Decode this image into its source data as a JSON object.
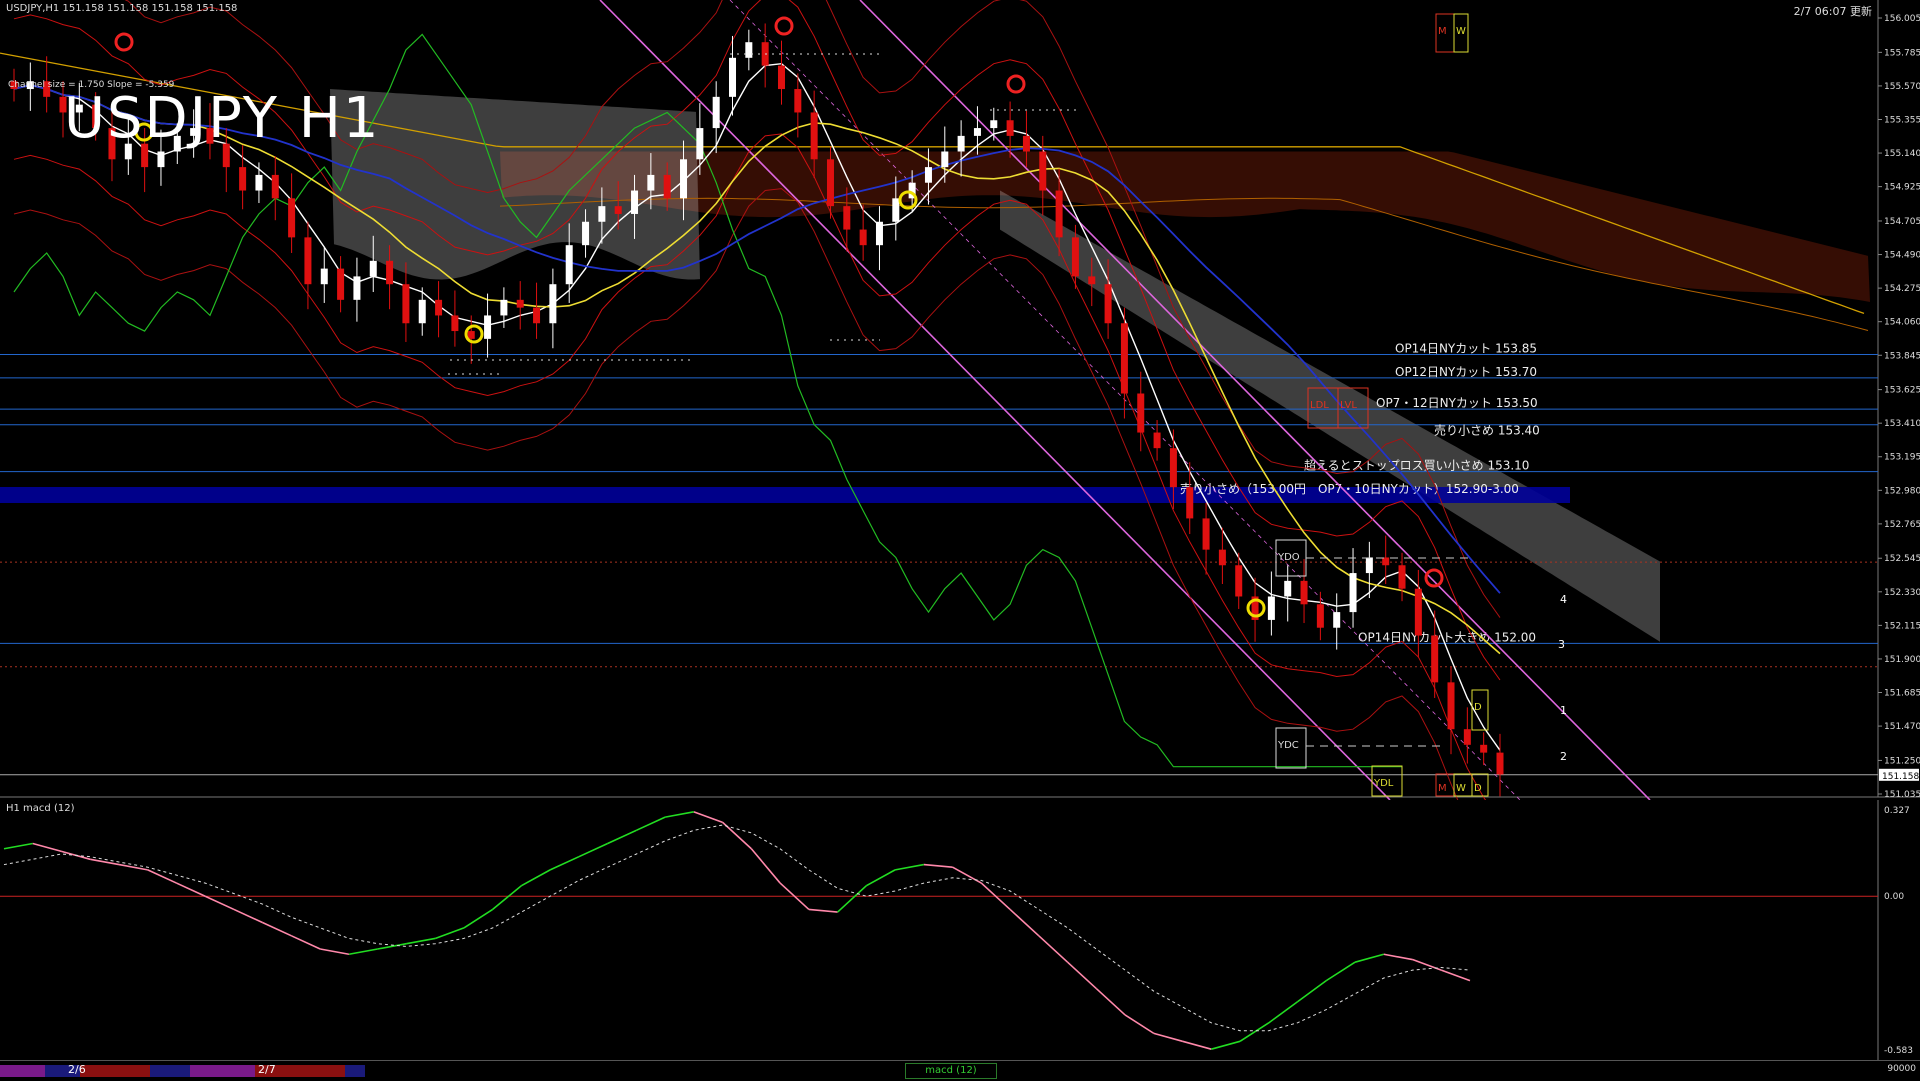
{
  "header": {
    "symbol_info": "USDJPY,H1  151.158 151.158 151.158 151.158",
    "channel_info": "Channel size = 1.750  Slope = -5.359",
    "big_title": "USDJPY H1",
    "datetime": "2/7 06:07 更新",
    "mw_markers": [
      "M",
      "W"
    ]
  },
  "macd_panel": {
    "title": "H1  macd (12)",
    "axis_labels": [
      "0.327",
      "0.00",
      "-0.583"
    ]
  },
  "bottom_bar": {
    "dates": [
      "2/6",
      "2/7"
    ],
    "status_tab": "macd (12)",
    "right_label": "90000"
  },
  "colors": {
    "bull_candle": "#ffffff",
    "bear_candle": "#e01010",
    "cloud_up": "#dddddd",
    "cloud_down": "#c03010",
    "level_band": "#000099",
    "macd_up": "#22dd22",
    "macd_down": "#ff88aa",
    "channel": "#dd66dd"
  },
  "chart_data": {
    "type": "candlestick",
    "symbol": "USDJPY",
    "timeframe": "H1",
    "ylim": [
      151.035,
      156.005
    ],
    "y_ticks": [
      156.005,
      155.785,
      155.57,
      155.355,
      155.14,
      154.925,
      154.705,
      154.49,
      154.275,
      154.06,
      153.845,
      153.625,
      153.41,
      153.195,
      152.98,
      152.765,
      152.545,
      152.33,
      152.115,
      151.9,
      151.685,
      151.47,
      151.25,
      151.035
    ],
    "current_price": "151.158",
    "candles_close": [
      155.55,
      155.6,
      155.5,
      155.4,
      155.45,
      155.3,
      155.1,
      155.2,
      155.05,
      155.15,
      155.25,
      155.3,
      155.2,
      155.05,
      154.9,
      155.0,
      154.85,
      154.6,
      154.3,
      154.4,
      154.2,
      154.35,
      154.45,
      154.3,
      154.05,
      154.2,
      154.1,
      154.0,
      153.95,
      154.1,
      154.2,
      154.15,
      154.05,
      154.3,
      154.55,
      154.7,
      154.8,
      154.75,
      154.9,
      155.0,
      154.85,
      155.1,
      155.3,
      155.5,
      155.75,
      155.85,
      155.7,
      155.55,
      155.4,
      155.1,
      154.8,
      154.65,
      154.55,
      154.7,
      154.85,
      154.95,
      155.05,
      155.15,
      155.25,
      155.3,
      155.35,
      155.25,
      155.15,
      154.9,
      154.6,
      154.35,
      154.3,
      154.05,
      153.6,
      153.35,
      153.25,
      153.0,
      152.8,
      152.6,
      152.5,
      152.3,
      152.15,
      152.3,
      152.4,
      152.25,
      152.1,
      152.2,
      152.45,
      152.55,
      152.5,
      152.35,
      152.05,
      151.75,
      151.45,
      151.35,
      151.3,
      151.16
    ],
    "annotations": [
      {
        "text": "OP14日NYカット 153.85",
        "price": 153.85
      },
      {
        "text": "OP12日NYカット 153.70",
        "price": 153.7
      },
      {
        "text": "OP7・12日NYカット 153.50",
        "price": 153.5
      },
      {
        "text": "売り小さめ 153.40",
        "price": 153.4
      },
      {
        "text": "超えるとストップロス買い小さめ 153.10",
        "price": 153.1
      },
      {
        "text": "売り小さめ（153.00円　OP7・10日NYカット）152.90-3.00",
        "price": 152.95
      },
      {
        "text": "OP14日NYカット大きめ 152.00",
        "price": 152.0
      }
    ],
    "box_labels": [
      "YDO",
      "YDC",
      "YDL",
      "LDL",
      "LVL",
      "M",
      "W",
      "D"
    ],
    "channel_numbers": [
      "1",
      "2",
      "3",
      "4"
    ],
    "macd_main": [
      0.18,
      0.2,
      0.17,
      0.14,
      0.12,
      0.1,
      0.05,
      0.0,
      -0.05,
      -0.1,
      -0.15,
      -0.2,
      -0.22,
      -0.2,
      -0.18,
      -0.16,
      -0.12,
      -0.05,
      0.04,
      0.1,
      0.15,
      0.2,
      0.25,
      0.3,
      0.32,
      0.28,
      0.18,
      0.05,
      -0.05,
      -0.06,
      0.04,
      0.1,
      0.12,
      0.11,
      0.05,
      -0.05,
      -0.15,
      -0.25,
      -0.35,
      -0.45,
      -0.52,
      -0.55,
      -0.58,
      -0.55,
      -0.48,
      -0.4,
      -0.32,
      -0.25,
      -0.22,
      -0.24,
      -0.28,
      -0.32
    ],
    "macd_signal": [
      0.12,
      0.14,
      0.16,
      0.15,
      0.13,
      0.11,
      0.08,
      0.05,
      0.01,
      -0.03,
      -0.08,
      -0.12,
      -0.16,
      -0.18,
      -0.19,
      -0.18,
      -0.16,
      -0.12,
      -0.06,
      0.0,
      0.06,
      0.11,
      0.16,
      0.21,
      0.25,
      0.27,
      0.24,
      0.18,
      0.1,
      0.03,
      0.0,
      0.02,
      0.05,
      0.07,
      0.06,
      0.02,
      -0.05,
      -0.12,
      -0.2,
      -0.28,
      -0.36,
      -0.42,
      -0.48,
      -0.51,
      -0.51,
      -0.48,
      -0.43,
      -0.37,
      -0.31,
      -0.28,
      -0.27,
      -0.28
    ]
  }
}
